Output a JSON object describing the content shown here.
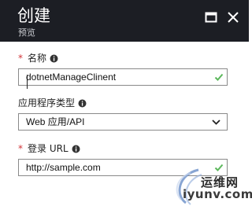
{
  "header": {
    "title": "创建",
    "subtitle": "预览"
  },
  "form": {
    "name_field": {
      "required_marker": "*",
      "label": "名称",
      "value": "dotnetManageClinent"
    },
    "app_type_field": {
      "label": "应用程序类型",
      "value": "Web 应用/API"
    },
    "login_url_field": {
      "required_marker": "*",
      "label": "登录 URL",
      "value": "http://sample.com"
    }
  },
  "watermark": {
    "name": "运维网",
    "url": "iyunv.com"
  },
  "colors": {
    "header_bg": "#1c1e24",
    "required": "#d13438",
    "valid_check": "#5cb85c"
  }
}
